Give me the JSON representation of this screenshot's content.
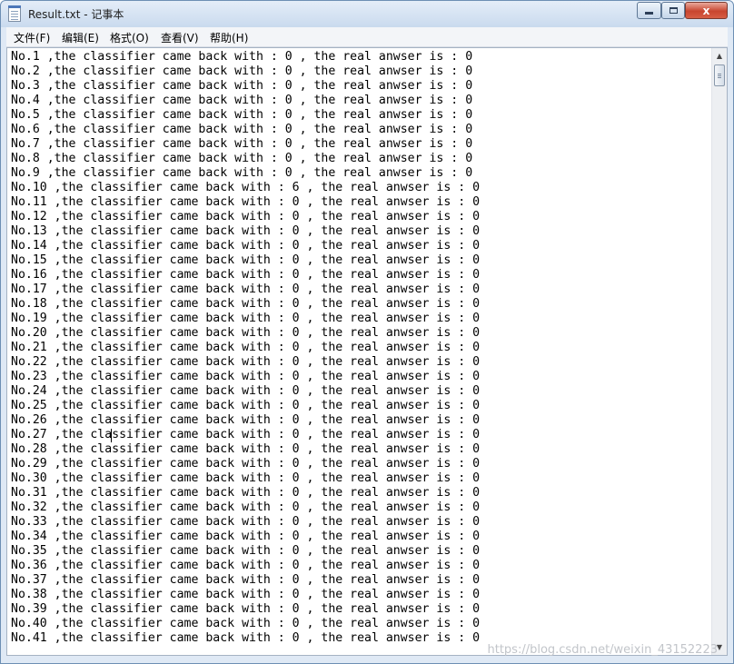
{
  "window": {
    "title": "Result.txt - 记事本",
    "icon": "notepad-icon",
    "controls": {
      "minimize": "minimize-icon",
      "maximize": "maximize-icon",
      "close_label": "x"
    }
  },
  "menu": [
    "文件(F)",
    "编辑(E)",
    "格式(O)",
    "查看(V)",
    "帮助(H)"
  ],
  "editor": {
    "lines": [
      "No.1 ,the classifier came back with : 0 , the real anwser is : 0",
      "No.2 ,the classifier came back with : 0 , the real anwser is : 0",
      "No.3 ,the classifier came back with : 0 , the real anwser is : 0",
      "No.4 ,the classifier came back with : 0 , the real anwser is : 0",
      "No.5 ,the classifier came back with : 0 , the real anwser is : 0",
      "No.6 ,the classifier came back with : 0 , the real anwser is : 0",
      "No.7 ,the classifier came back with : 0 , the real anwser is : 0",
      "No.8 ,the classifier came back with : 0 , the real anwser is : 0",
      "No.9 ,the classifier came back with : 0 , the real anwser is : 0",
      "No.10 ,the classifier came back with : 6 , the real anwser is : 0",
      "No.11 ,the classifier came back with : 0 , the real anwser is : 0",
      "No.12 ,the classifier came back with : 0 , the real anwser is : 0",
      "No.13 ,the classifier came back with : 0 , the real anwser is : 0",
      "No.14 ,the classifier came back with : 0 , the real anwser is : 0",
      "No.15 ,the classifier came back with : 0 , the real anwser is : 0",
      "No.16 ,the classifier came back with : 0 , the real anwser is : 0",
      "No.17 ,the classifier came back with : 0 , the real anwser is : 0",
      "No.18 ,the classifier came back with : 0 , the real anwser is : 0",
      "No.19 ,the classifier came back with : 0 , the real anwser is : 0",
      "No.20 ,the classifier came back with : 0 , the real anwser is : 0",
      "No.21 ,the classifier came back with : 0 , the real anwser is : 0",
      "No.22 ,the classifier came back with : 0 , the real anwser is : 0",
      "No.23 ,the classifier came back with : 0 , the real anwser is : 0",
      "No.24 ,the classifier came back with : 0 , the real anwser is : 0",
      "No.25 ,the classifier came back with : 0 , the real anwser is : 0",
      "No.26 ,the classifier came back with : 0 , the real anwser is : 0",
      "No.27 ,the classifier came back with : 0 , the real anwser is : 0",
      "No.28 ,the classifier came back with : 0 , the real anwser is : 0",
      "No.29 ,the classifier came back with : 0 , the real anwser is : 0",
      "No.30 ,the classifier came back with : 0 , the real anwser is : 0",
      "No.31 ,the classifier came back with : 0 , the real anwser is : 0",
      "No.32 ,the classifier came back with : 0 , the real anwser is : 0",
      "No.33 ,the classifier came back with : 0 , the real anwser is : 0",
      "No.34 ,the classifier came back with : 0 , the real anwser is : 0",
      "No.35 ,the classifier came back with : 0 , the real anwser is : 0",
      "No.36 ,the classifier came back with : 0 , the real anwser is : 0",
      "No.37 ,the classifier came back with : 0 , the real anwser is : 0",
      "No.38 ,the classifier came back with : 0 , the real anwser is : 0",
      "No.39 ,the classifier came back with : 0 , the real anwser is : 0",
      "No.40 ,the classifier came back with : 0 , the real anwser is : 0",
      "No.41 ,the classifier came back with : 0 , the real anwser is : 0"
    ]
  },
  "scrollbar": {
    "up_icon": "scroll-up-arrow-icon",
    "down_icon": "scroll-down-arrow-icon"
  },
  "watermark": "https://blog.csdn.net/weixin_43152223"
}
